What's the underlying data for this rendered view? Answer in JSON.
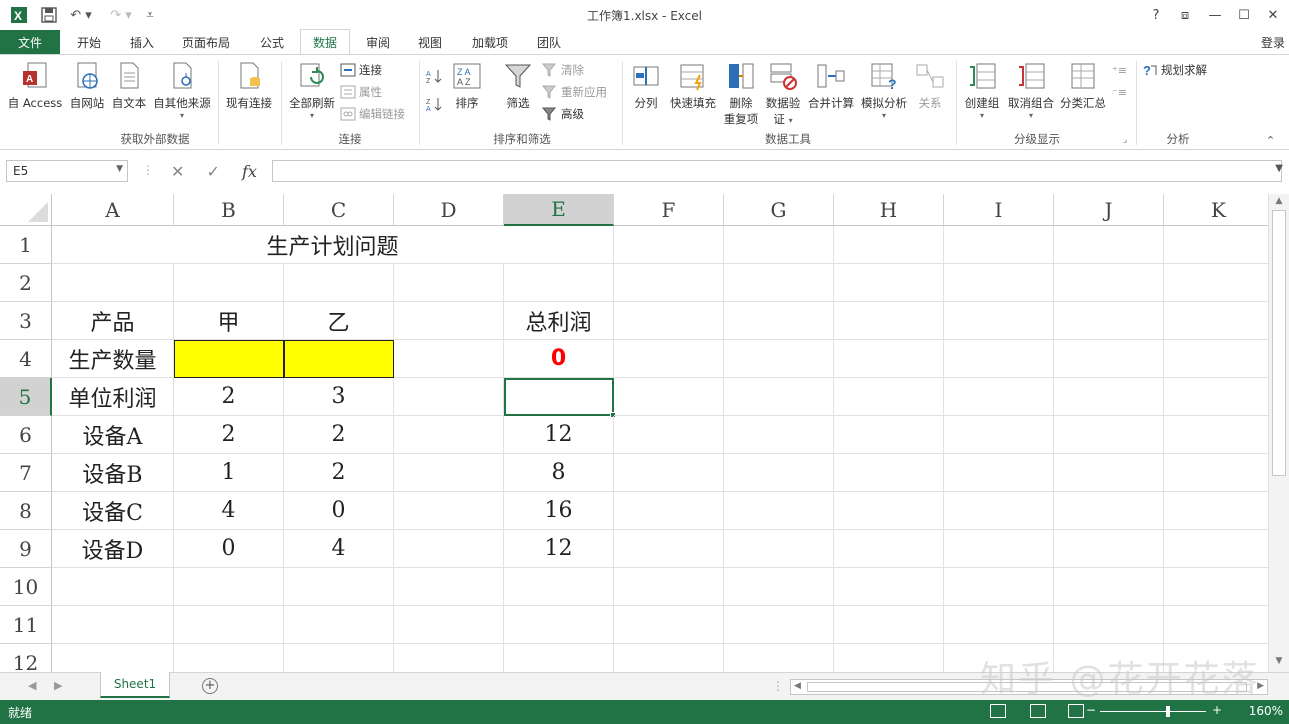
{
  "titlebar": {
    "title": "工作簿1.xlsx - Excel",
    "help": "?",
    "restore_ribbon": "⧈",
    "minimize": "—",
    "maximize": "☐",
    "close": "✕"
  },
  "tabs": {
    "file": "文件",
    "items": [
      "开始",
      "插入",
      "页面布局",
      "公式",
      "数据",
      "审阅",
      "视图",
      "加载项",
      "团队"
    ],
    "active": "数据",
    "login": "登录"
  },
  "ribbon": {
    "groups": {
      "external": "获取外部数据",
      "connections": "连接",
      "sort_filter": "排序和筛选",
      "data_tools": "数据工具",
      "outline": "分级显示",
      "analysis": "分析"
    },
    "buttons": {
      "from_access": "自 Access",
      "from_web": "自网站",
      "from_text": "自文本",
      "from_other": "自其他来源",
      "existing": "现有连接",
      "refresh_all": "全部刷新",
      "connections": "连接",
      "properties": "属性",
      "edit_links": "编辑链接",
      "sort": "排序",
      "filter": "筛选",
      "clear": "清除",
      "reapply": "重新应用",
      "advanced": "高级",
      "text_to_cols": "分列",
      "flash_fill": "快速填充",
      "remove_dup_1": "删除",
      "remove_dup_2": "重复项",
      "validation_1": "数据验",
      "validation_2": "证",
      "consolidate": "合并计算",
      "whatif": "模拟分析",
      "relationships": "关系",
      "group": "创建组",
      "ungroup": "取消组合",
      "subtotal": "分类汇总",
      "solver": "规划求解"
    }
  },
  "formula_bar": {
    "name_box": "E5",
    "fx": "fx",
    "cancel": "✕",
    "enter": "✓",
    "value": ""
  },
  "columns": [
    "A",
    "B",
    "C",
    "D",
    "E",
    "F",
    "G",
    "H",
    "I",
    "J",
    "K"
  ],
  "rows": [
    "1",
    "2",
    "3",
    "4",
    "5",
    "6",
    "7",
    "8",
    "9",
    "10",
    "11",
    "12"
  ],
  "cells": {
    "A1": "生产计划问题",
    "A3": "产品",
    "B3": "甲",
    "C3": "乙",
    "E3": "总利润",
    "A4": "生产数量",
    "E4": "0",
    "A5": "单位利润",
    "B5": "2",
    "C5": "3",
    "A6": "设备A",
    "B6": "2",
    "C6": "2",
    "E6": "12",
    "A7": "设备B",
    "B7": "1",
    "C7": "2",
    "E7": "8",
    "A8": "设备C",
    "B8": "4",
    "C8": "0",
    "E8": "16",
    "A9": "设备D",
    "B9": "0",
    "C9": "4",
    "E9": "12"
  },
  "selected_cell": "E5",
  "colors": {
    "accent": "#217346",
    "highlight": "#ffff00",
    "result": "#ff0000"
  },
  "sheet": {
    "tab": "Sheet1",
    "add": "+"
  },
  "status": {
    "ready": "就绪",
    "zoom": "160%",
    "zoom_out": "−",
    "zoom_in": "+"
  },
  "watermark": "知乎 @花开花落"
}
